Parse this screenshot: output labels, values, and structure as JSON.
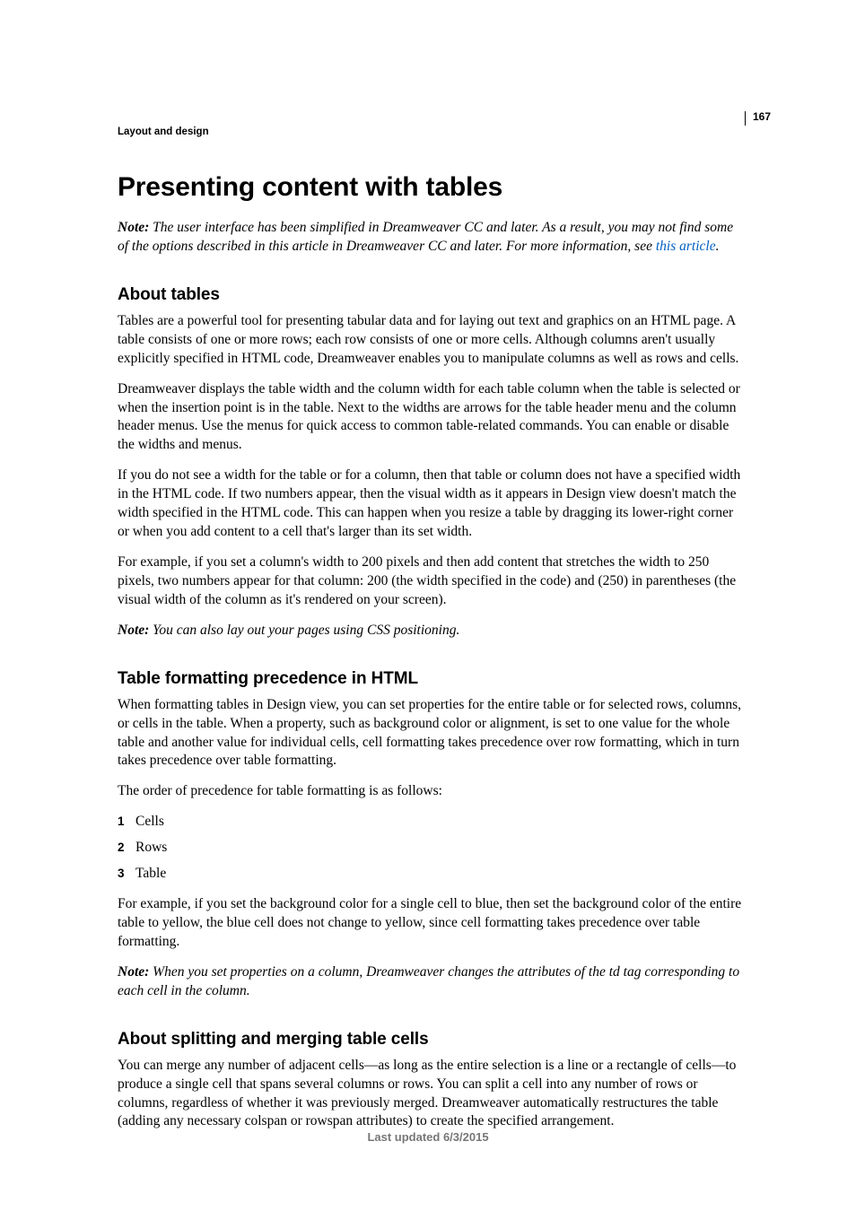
{
  "page_number": "167",
  "running_head": "Layout and design",
  "title": "Presenting content with tables",
  "intro_note": {
    "label": "Note:",
    "text_before_link": " The user interface has been simplified in Dreamweaver CC and later. As a result, you may not find some of the options described in this article in Dreamweaver CC and later. For more information, see ",
    "link_text": "this article",
    "text_after_link": "."
  },
  "sections": {
    "about_tables": {
      "heading": "About tables",
      "paragraphs": [
        "Tables are a powerful tool for presenting tabular data and for laying out text and graphics on an HTML page. A table consists of one or more rows; each row consists of one or more cells. Although columns aren't usually explicitly specified in HTML code, Dreamweaver enables you to manipulate columns as well as rows and cells.",
        "Dreamweaver displays the table width and the column width for each table column when the table is selected or when the insertion point is in the table. Next to the widths are arrows for the table header menu and the column header menus. Use the menus for quick access to common table-related commands. You can enable or disable the widths and menus.",
        "If you do not see a width for the table or for a column, then that table or column does not have a specified width in the HTML code. If two numbers appear, then the visual width as it appears in Design view doesn't match the width specified in the HTML code. This can happen when you resize a table by dragging its lower-right corner or when you add content to a cell that's larger than its set width.",
        "For example, if you set a column's width to 200 pixels and then add content that stretches the width to 250 pixels, two numbers appear for that column: 200 (the width specified in the code) and (250) in parentheses (the visual width of the column as it's rendered on your screen)."
      ],
      "note": {
        "label": "Note:",
        "text": " You can also lay out your pages using CSS positioning."
      }
    },
    "formatting_precedence": {
      "heading": "Table formatting precedence in HTML",
      "intro": "When formatting tables in Design view, you can set properties for the entire table or for selected rows, columns, or cells in the table. When a property, such as background color or alignment, is set to one value for the whole table and another value for individual cells, cell formatting takes precedence over row formatting, which in turn takes precedence over table formatting.",
      "order_label": "The order of precedence for table formatting is as follows:",
      "items": [
        "Cells",
        "Rows",
        "Table"
      ],
      "example": "For example, if you set the background color for a single cell to blue, then set the background color of the entire table to yellow, the blue cell does not change to yellow, since cell formatting takes precedence over table formatting.",
      "note": {
        "label": "Note:",
        "text": " When you set properties on a column, Dreamweaver changes the attributes of the td tag corresponding to each cell in the column."
      }
    },
    "splitting_merging": {
      "heading": "About splitting and merging table cells",
      "paragraph": "You can merge any number of adjacent cells—as long as the entire selection is a line or a rectangle of cells—to produce a single cell that spans several columns or rows. You can split a cell into any number of rows or columns, regardless of whether it was previously merged. Dreamweaver automatically restructures the table (adding any necessary colspan or rowspan attributes) to create the specified arrangement."
    }
  },
  "footer": "Last updated 6/3/2015"
}
